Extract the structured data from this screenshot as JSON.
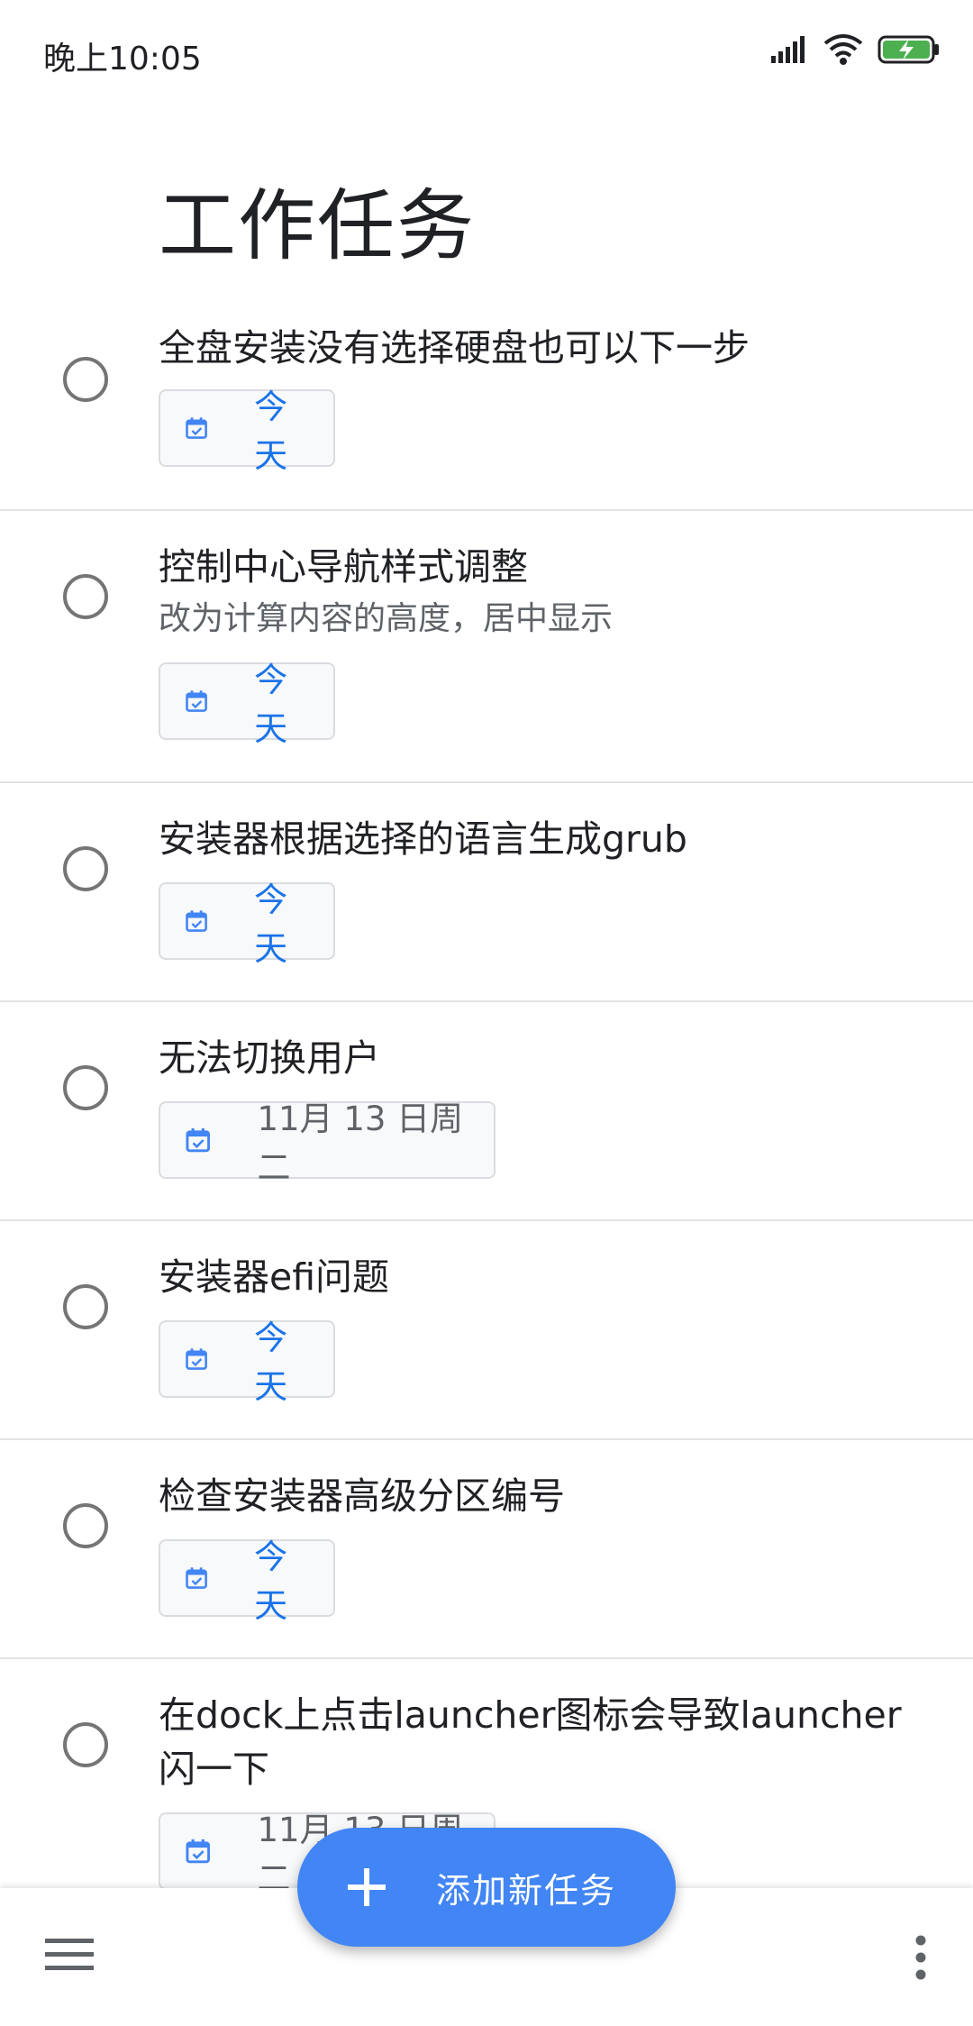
{
  "status_bar": {
    "time": "晚上10:05",
    "icons": [
      "signal-icon",
      "wifi-icon",
      "battery-charging-icon"
    ],
    "battery_color": "#4caf50"
  },
  "page_title": "工作任务",
  "tasks": [
    {
      "title": "全盘安装没有选择硬盘也可以下一步",
      "note": "",
      "due": "今天"
    },
    {
      "title": "控制中心导航样式调整",
      "note": "改为计算内容的高度，居中显示",
      "due": "今天"
    },
    {
      "title": "安装器根据选择的语言生成grub",
      "note": "",
      "due": "今天"
    },
    {
      "title": "无法切换用户",
      "note": "",
      "due": "11月 13 日周二"
    },
    {
      "title": "安装器efi问题",
      "note": "",
      "due": "今天"
    },
    {
      "title": "检查安装器高级分区编号",
      "note": "",
      "due": "今天"
    },
    {
      "title": "在dock上点击launcher图标会导致launcher闪一下",
      "note": "",
      "due": "11月 13 日周二"
    }
  ],
  "fab": {
    "label": "添加新任务",
    "icon": "plus-icon"
  },
  "bottom_bar": {
    "left_icon": "menu-icon",
    "right_icon": "more-vert-icon"
  },
  "colors": {
    "accent": "#4285f4",
    "chip_today_text": "#1a73e8",
    "divider": "#e3e3e3"
  }
}
